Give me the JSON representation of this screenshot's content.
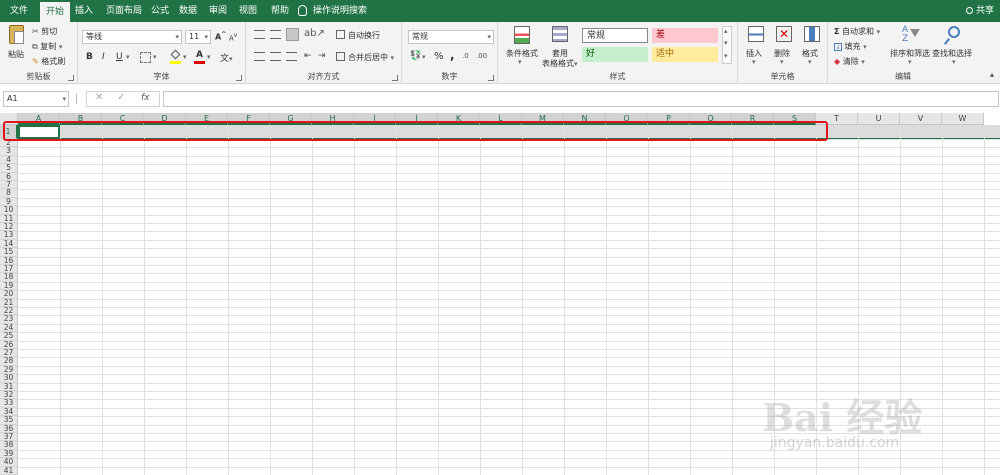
{
  "tabs": {
    "file": "文件",
    "home": "开始",
    "insert": "插入",
    "layout": "页面布局",
    "formulas": "公式",
    "data": "数据",
    "review": "审阅",
    "view": "视图",
    "help": "帮助",
    "search": "操作说明搜索",
    "share": "共享"
  },
  "ribbon": {
    "clipboard": {
      "label": "剪贴板",
      "paste": "粘贴",
      "cut": "剪切",
      "copy": "复制",
      "format_painter": "格式刷"
    },
    "font": {
      "label": "字体",
      "font_name": "等线",
      "font_size": "11",
      "bold": "B",
      "italic": "I",
      "underline": "U",
      "grow": "A",
      "shrink": "A",
      "wen": "文"
    },
    "alignment": {
      "label": "对齐方式",
      "wrap": "自动换行",
      "merge": "合并后居中"
    },
    "number": {
      "label": "数字",
      "format": "常规",
      "percent": "%",
      "comma": ","
    },
    "styles": {
      "label": "样式",
      "conditional": "条件格式",
      "table_1": "套用",
      "table_2": "表格格式",
      "normal": "常规",
      "bad": "差",
      "good": "好",
      "neutral": "适中"
    },
    "cells": {
      "label": "单元格",
      "insert": "插入",
      "delete": "删除",
      "format": "格式"
    },
    "editing": {
      "label": "编辑",
      "autosum": "自动求和",
      "fill": "填充",
      "clear": "清除",
      "sort": "排序和筛选",
      "find": "查找和选择"
    }
  },
  "formula_bar": {
    "name_box": "A1",
    "fx": "fx"
  },
  "sheet": {
    "columns": [
      "A",
      "B",
      "C",
      "D",
      "E",
      "F",
      "G",
      "H",
      "I",
      "J",
      "K",
      "L",
      "M",
      "N",
      "O",
      "P",
      "Q",
      "R",
      "S",
      "T",
      "U",
      "V",
      "W"
    ],
    "rows": [
      "1",
      "2",
      "3",
      "4",
      "5",
      "6",
      "7",
      "8",
      "9",
      "10",
      "11",
      "12",
      "13",
      "14",
      "15",
      "16",
      "17",
      "18",
      "19",
      "20",
      "21",
      "22",
      "23",
      "24",
      "25",
      "26",
      "27",
      "28",
      "29",
      "30",
      "31",
      "32",
      "33",
      "34",
      "35",
      "36",
      "37",
      "38",
      "39",
      "40",
      "41"
    ],
    "selected_row": "1",
    "active_cell": "A1"
  },
  "watermark": {
    "brand": "Bai 经验",
    "url": "jingyan.baidu.com"
  },
  "colors": {
    "accent": "#217346",
    "highlight": "#e0141b",
    "bad_bg": "#ffc7ce",
    "bad_fg": "#9c0006",
    "good_bg": "#c6efce",
    "good_fg": "#006100",
    "neutral_bg": "#ffeb9c",
    "neutral_fg": "#9c6500"
  }
}
